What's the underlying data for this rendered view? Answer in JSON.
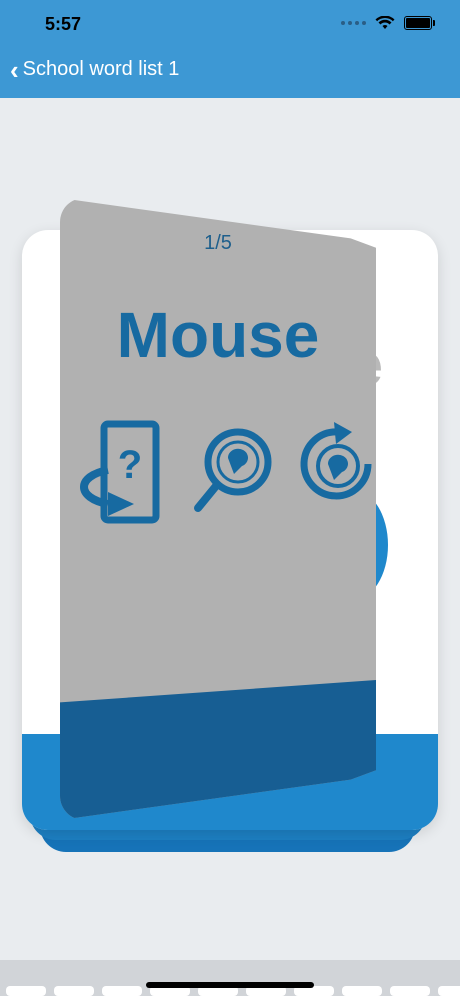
{
  "status": {
    "time": "5:57"
  },
  "nav": {
    "back_label": "School word list 1"
  },
  "card": {
    "counter": "1/5",
    "word": "Mouse",
    "back_ghost_text": "e"
  },
  "colors": {
    "header": "#3d98d4",
    "card_word": "#176aa1",
    "card_front_bg": "#b1b1b1",
    "card_band": "#175e93",
    "card_back_footer": "#1f88cc"
  },
  "icons": [
    "flip-card-question-icon",
    "search-speech-icon",
    "refresh-speech-icon"
  ]
}
